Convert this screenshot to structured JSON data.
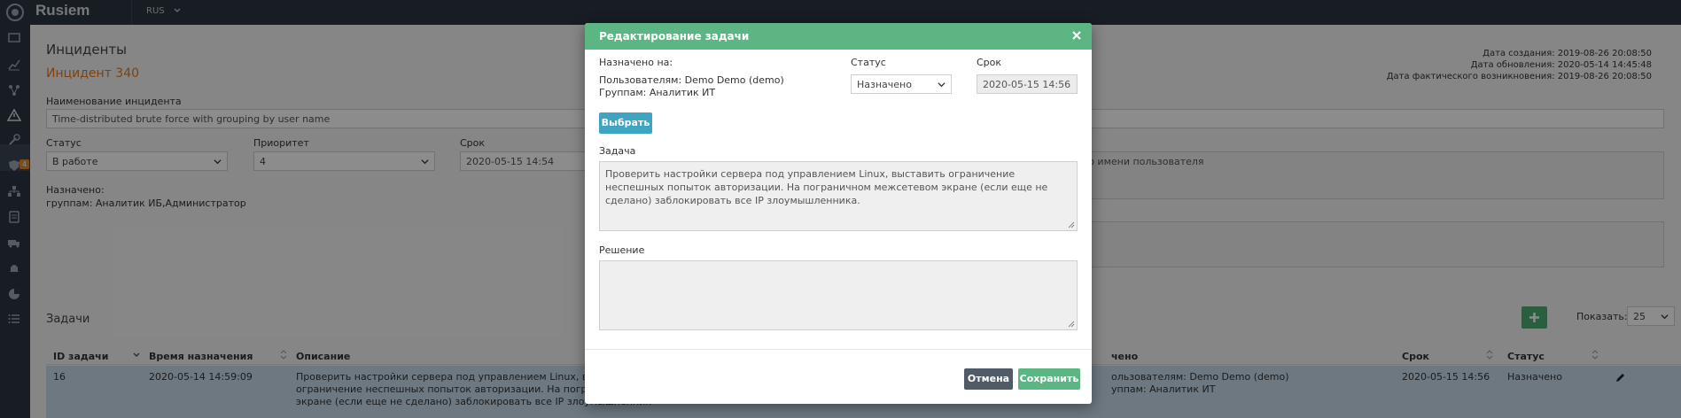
{
  "app": {
    "name": "Rusiem",
    "language": "RUS"
  },
  "sidebar": {
    "icons": [
      "monitor-icon",
      "chart-icon",
      "network-icon",
      "warning-icon",
      "wrench-icon",
      "shield-icon",
      "org-chart-icon",
      "database-icon",
      "truck-icon",
      "bell-icon",
      "pie-chart-icon",
      "list-icon"
    ],
    "active_badge": "4"
  },
  "page": {
    "section_title": "Инциденты",
    "incident_title": "Инцидент 340",
    "meta": {
      "created": "Дата создания: 2019-08-26 20:08:50",
      "updated": "Дата обновления: 2020-05-14 14:45:48",
      "occurred": "Дата фактического возникновения: 2019-08-26 20:08:50"
    },
    "name_label": "Наименование инцидента",
    "name_value": "Time-distributed brute force with grouping by user name",
    "status_label": "Статус",
    "status_value": "В работе",
    "priority_label": "Приоритет",
    "priority_value": "4",
    "deadline_label": "Срок",
    "deadline_value": "2020-05-15 14:54",
    "assigned_label": "Назначено:",
    "assigned_groups": "группам: Аналитик ИБ,Администратор",
    "description_partial": "по имени пользователя",
    "tasks_title": "Задачи",
    "show_label": "Показать:",
    "page_size": "25"
  },
  "table": {
    "headers": {
      "id": "ID задачи",
      "assigned_time": "Время назначения",
      "description": "Описание",
      "assigned": "чено",
      "deadline": "Срок",
      "status": "Статус"
    },
    "row": {
      "id": "16",
      "assigned_time": "2020-05-14 14:59:09",
      "desc_line1": "Проверить настройки сервера под управлением Linux, выстави",
      "desc_line2": "ограничение неспешных попыток авторизации. На пограничн",
      "desc_line3": "экране (если еще не сделано) заблокировать все IP злоумышленник",
      "assigned_line1": "ользователям: Demo Demo (demo)",
      "assigned_line2": "уппам: Аналитик ИТ",
      "deadline": "2020-05-15 14:56",
      "status": "Назначено"
    }
  },
  "modal": {
    "title": "Редактирование задачи",
    "assigned_to_label": "Назначено на:",
    "users_line": "Пользователям: Demo Demo (demo)",
    "groups_line": "Группам: Аналитик ИТ",
    "status_label": "Статус",
    "status_value": "Назначено",
    "deadline_label": "Срок",
    "deadline_value": "2020-05-15 14:56",
    "select_button": "Выбрать",
    "task_label": "Задача",
    "task_text": "Проверить настройки сервера под  управлением Linux, выставить ограничение неспешных попыток авторизации. На пограничном межсетевом экране (если еще не сделано) заблокировать все IP злоумышленника.",
    "solution_label": "Решение",
    "solution_text": "",
    "cancel_button": "Отмена",
    "save_button": "Сохранить"
  }
}
